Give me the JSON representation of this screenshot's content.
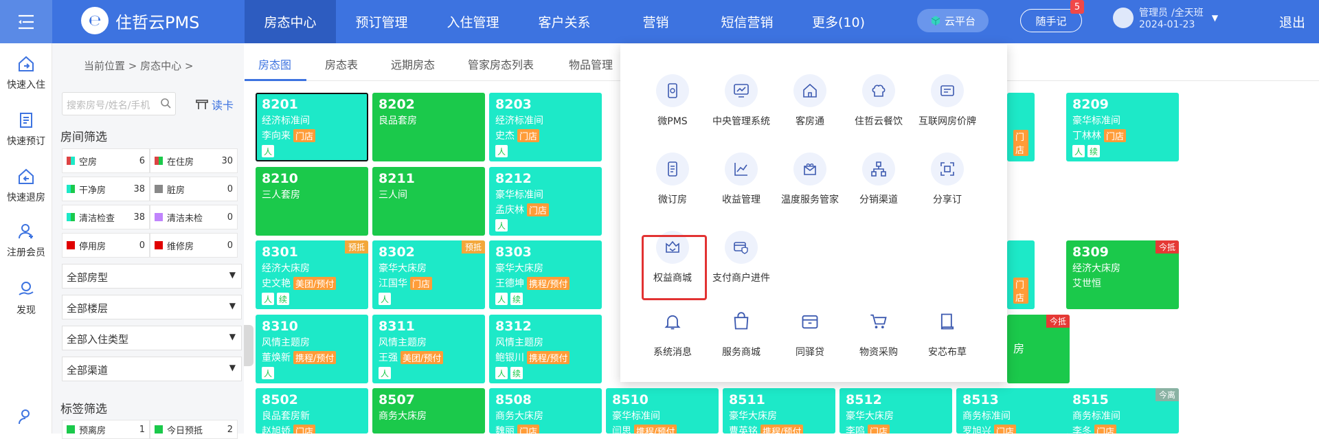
{
  "topbar": {
    "logo_text": "住哲云PMS",
    "nav": [
      "房态中心",
      "预订管理",
      "入住管理",
      "客户关系",
      "营销",
      "短信营销",
      "更多(10)"
    ],
    "cloud_platform": "云平台",
    "notes": "随手记",
    "notes_badge": "5",
    "user_role": "管理员",
    "user_shift": "/全天班",
    "user_date": "2024-01-23",
    "logout": "退出"
  },
  "rail": [
    "快速入住",
    "快速预订",
    "快速退房",
    "注册会员",
    "发现"
  ],
  "sidebar": {
    "breadcrumb": "当前位置 > 房态中心 >",
    "search_placeholder": "搜索房号/姓名/手机",
    "read_card": "读卡",
    "room_filter_title": "房间筛选",
    "filters": [
      {
        "label": "空房",
        "count": "6",
        "color": "#1de9c8"
      },
      {
        "label": "在住房",
        "count": "30",
        "color": "#1bc94b"
      },
      {
        "label": "干净房",
        "count": "38",
        "color": "#1de9c8"
      },
      {
        "label": "脏房",
        "count": "0",
        "color": "#888888"
      },
      {
        "label": "清洁检查",
        "count": "38",
        "color": "#1de9c8"
      },
      {
        "label": "清洁未检",
        "count": "0",
        "color": "#c084fc"
      },
      {
        "label": "停用房",
        "count": "0",
        "color": "#e00000"
      },
      {
        "label": "维修房",
        "count": "0",
        "color": "#e00000"
      }
    ],
    "selects": [
      "全部房型",
      "全部楼层",
      "全部入住类型",
      "全部渠道"
    ],
    "tag_filter_title": "标签筛选",
    "tag_items": [
      {
        "label": "预离房",
        "count": "1"
      },
      {
        "label": "今日预抵",
        "count": "2"
      }
    ]
  },
  "tabs": [
    "房态图",
    "房态表",
    "远期房态",
    "管家房态列表",
    "物品管理"
  ],
  "rooms": [
    {
      "num": "8201",
      "type": "经济标准间",
      "guest": "李向来",
      "tag": "门店",
      "style": "teal",
      "icons": [
        "人"
      ]
    },
    {
      "num": "8202",
      "type": "良品套房",
      "guest": "",
      "tag": "",
      "style": "green",
      "icons": []
    },
    {
      "num": "8203",
      "type": "经济标准间",
      "guest": "史杰",
      "tag": "门店",
      "style": "teal",
      "icons": [
        "人"
      ]
    },
    {
      "num": "8209",
      "type": "豪华标准间",
      "guest": "丁林林",
      "tag": "门店",
      "style": "teal",
      "icons": [
        "人",
        "续"
      ]
    },
    {
      "num": "8210",
      "type": "三人套房",
      "guest": "",
      "tag": "",
      "style": "green",
      "icons": []
    },
    {
      "num": "8211",
      "type": "三人间",
      "guest": "",
      "tag": "",
      "style": "green",
      "icons": []
    },
    {
      "num": "8212",
      "type": "豪华标准间",
      "guest": "孟庆林",
      "tag": "门店",
      "style": "teal",
      "icons": [
        "人"
      ]
    },
    {
      "num": "8301",
      "type": "经济大床房",
      "guest": "史文艳",
      "tag": "美团/预付",
      "style": "teal",
      "icons": [
        "人",
        "续"
      ],
      "corner": "预抵"
    },
    {
      "num": "8302",
      "type": "豪华大床房",
      "guest": "江国华",
      "tag": "门店",
      "style": "teal",
      "icons": [
        "人"
      ],
      "corner": "预抵"
    },
    {
      "num": "8303",
      "type": "豪华大床房",
      "guest": "王德坤",
      "tag": "携程/预付",
      "style": "teal",
      "icons": [
        "人",
        "续"
      ]
    },
    {
      "num": "8309",
      "type": "经济大床房",
      "guest": "艾世恒",
      "tag": "",
      "style": "green",
      "icons": [],
      "corner": "今抵"
    },
    {
      "num": "8310",
      "type": "风情主题房",
      "guest": "董焕新",
      "tag": "携程/预付",
      "style": "teal",
      "icons": [
        "人"
      ]
    },
    {
      "num": "8311",
      "type": "风情主题房",
      "guest": "王强",
      "tag": "美团/预付",
      "style": "teal",
      "icons": [
        "人"
      ]
    },
    {
      "num": "8312",
      "type": "风情主题房",
      "guest": "鲍银川",
      "tag": "携程/预付",
      "style": "teal",
      "icons": [
        "人",
        "续"
      ]
    },
    {
      "num": "8502",
      "type": "良品套房新",
      "guest": "赵旭娇",
      "tag": "门店",
      "style": "teal",
      "icons": []
    },
    {
      "num": "8507",
      "type": "商务大床房",
      "guest": "",
      "tag": "",
      "style": "green",
      "icons": []
    },
    {
      "num": "8508",
      "type": "商务大床房",
      "guest": "魏丽",
      "tag": "门店",
      "style": "teal",
      "icons": []
    },
    {
      "num": "8510",
      "type": "豪华标准间",
      "guest": "闫思",
      "tag": "携程/预付",
      "style": "teal",
      "icons": []
    },
    {
      "num": "8511",
      "type": "豪华大床房",
      "guest": "曹英铭",
      "tag": "携程/预付",
      "style": "teal",
      "icons": []
    },
    {
      "num": "8512",
      "type": "豪华大床房",
      "guest": "李鸣",
      "tag": "门店",
      "style": "teal",
      "icons": []
    },
    {
      "num": "8513",
      "type": "商务标准间",
      "guest": "罗旭兴",
      "tag": "门店",
      "style": "teal",
      "icons": []
    },
    {
      "num": "8515",
      "type": "商务标准间",
      "guest": "李冬",
      "tag": "门店",
      "style": "teal",
      "icons": [],
      "corner": "今离"
    }
  ],
  "partial_cards": {
    "c8209_left_tag": "门店",
    "c8309_left_tag": "门店",
    "c8310_right_text": "房",
    "c8310_right_corner": "今抵"
  },
  "popup": [
    {
      "label": "微PMS",
      "icon": "phone-icon"
    },
    {
      "label": "中央管理系统",
      "icon": "monitor-chart-icon"
    },
    {
      "label": "客房通",
      "icon": "house-icon"
    },
    {
      "label": "住哲云餐饮",
      "icon": "chef-hat-icon"
    },
    {
      "label": "互联网房价牌",
      "icon": "price-board-icon"
    },
    {
      "label": "微订房",
      "icon": "mobile-booking-icon"
    },
    {
      "label": "收益管理",
      "icon": "line-chart-icon"
    },
    {
      "label": "温度服务管家",
      "icon": "gift-heart-icon"
    },
    {
      "label": "分销渠道",
      "icon": "network-icon"
    },
    {
      "label": "分享订",
      "icon": "scan-share-icon"
    },
    {
      "label": "权益商城",
      "icon": "crown-shop-icon"
    },
    {
      "label": "支付商户进件",
      "icon": "card-shield-icon"
    },
    {
      "label": "系统消息",
      "icon": "bell-icon"
    },
    {
      "label": "服务商城",
      "icon": "shopping-bag-icon"
    },
    {
      "label": "同驿贷",
      "icon": "safe-box-icon"
    },
    {
      "label": "物资采购",
      "icon": "cart-icon"
    },
    {
      "label": "安芯布草",
      "icon": "book-icon"
    }
  ]
}
